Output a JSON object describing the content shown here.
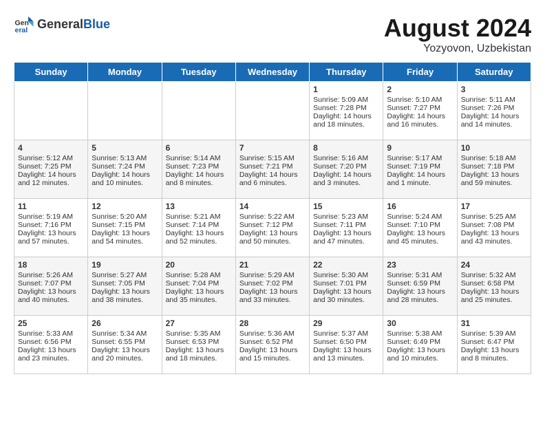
{
  "header": {
    "logo": {
      "general": "General",
      "blue": "Blue"
    },
    "title": "August 2024",
    "subtitle": "Yozyovon, Uzbekistan"
  },
  "days_of_week": [
    "Sunday",
    "Monday",
    "Tuesday",
    "Wednesday",
    "Thursday",
    "Friday",
    "Saturday"
  ],
  "weeks": [
    [
      {
        "day": "",
        "content": ""
      },
      {
        "day": "",
        "content": ""
      },
      {
        "day": "",
        "content": ""
      },
      {
        "day": "",
        "content": ""
      },
      {
        "day": "1",
        "content": "Sunrise: 5:09 AM\nSunset: 7:28 PM\nDaylight: 14 hours\nand 18 minutes."
      },
      {
        "day": "2",
        "content": "Sunrise: 5:10 AM\nSunset: 7:27 PM\nDaylight: 14 hours\nand 16 minutes."
      },
      {
        "day": "3",
        "content": "Sunrise: 5:11 AM\nSunset: 7:26 PM\nDaylight: 14 hours\nand 14 minutes."
      }
    ],
    [
      {
        "day": "4",
        "content": "Sunrise: 5:12 AM\nSunset: 7:25 PM\nDaylight: 14 hours\nand 12 minutes."
      },
      {
        "day": "5",
        "content": "Sunrise: 5:13 AM\nSunset: 7:24 PM\nDaylight: 14 hours\nand 10 minutes."
      },
      {
        "day": "6",
        "content": "Sunrise: 5:14 AM\nSunset: 7:23 PM\nDaylight: 14 hours\nand 8 minutes."
      },
      {
        "day": "7",
        "content": "Sunrise: 5:15 AM\nSunset: 7:21 PM\nDaylight: 14 hours\nand 6 minutes."
      },
      {
        "day": "8",
        "content": "Sunrise: 5:16 AM\nSunset: 7:20 PM\nDaylight: 14 hours\nand 3 minutes."
      },
      {
        "day": "9",
        "content": "Sunrise: 5:17 AM\nSunset: 7:19 PM\nDaylight: 14 hours\nand 1 minute."
      },
      {
        "day": "10",
        "content": "Sunrise: 5:18 AM\nSunset: 7:18 PM\nDaylight: 13 hours\nand 59 minutes."
      }
    ],
    [
      {
        "day": "11",
        "content": "Sunrise: 5:19 AM\nSunset: 7:16 PM\nDaylight: 13 hours\nand 57 minutes."
      },
      {
        "day": "12",
        "content": "Sunrise: 5:20 AM\nSunset: 7:15 PM\nDaylight: 13 hours\nand 54 minutes."
      },
      {
        "day": "13",
        "content": "Sunrise: 5:21 AM\nSunset: 7:14 PM\nDaylight: 13 hours\nand 52 minutes."
      },
      {
        "day": "14",
        "content": "Sunrise: 5:22 AM\nSunset: 7:12 PM\nDaylight: 13 hours\nand 50 minutes."
      },
      {
        "day": "15",
        "content": "Sunrise: 5:23 AM\nSunset: 7:11 PM\nDaylight: 13 hours\nand 47 minutes."
      },
      {
        "day": "16",
        "content": "Sunrise: 5:24 AM\nSunset: 7:10 PM\nDaylight: 13 hours\nand 45 minutes."
      },
      {
        "day": "17",
        "content": "Sunrise: 5:25 AM\nSunset: 7:08 PM\nDaylight: 13 hours\nand 43 minutes."
      }
    ],
    [
      {
        "day": "18",
        "content": "Sunrise: 5:26 AM\nSunset: 7:07 PM\nDaylight: 13 hours\nand 40 minutes."
      },
      {
        "day": "19",
        "content": "Sunrise: 5:27 AM\nSunset: 7:05 PM\nDaylight: 13 hours\nand 38 minutes."
      },
      {
        "day": "20",
        "content": "Sunrise: 5:28 AM\nSunset: 7:04 PM\nDaylight: 13 hours\nand 35 minutes."
      },
      {
        "day": "21",
        "content": "Sunrise: 5:29 AM\nSunset: 7:02 PM\nDaylight: 13 hours\nand 33 minutes."
      },
      {
        "day": "22",
        "content": "Sunrise: 5:30 AM\nSunset: 7:01 PM\nDaylight: 13 hours\nand 30 minutes."
      },
      {
        "day": "23",
        "content": "Sunrise: 5:31 AM\nSunset: 6:59 PM\nDaylight: 13 hours\nand 28 minutes."
      },
      {
        "day": "24",
        "content": "Sunrise: 5:32 AM\nSunset: 6:58 PM\nDaylight: 13 hours\nand 25 minutes."
      }
    ],
    [
      {
        "day": "25",
        "content": "Sunrise: 5:33 AM\nSunset: 6:56 PM\nDaylight: 13 hours\nand 23 minutes."
      },
      {
        "day": "26",
        "content": "Sunrise: 5:34 AM\nSunset: 6:55 PM\nDaylight: 13 hours\nand 20 minutes."
      },
      {
        "day": "27",
        "content": "Sunrise: 5:35 AM\nSunset: 6:53 PM\nDaylight: 13 hours\nand 18 minutes."
      },
      {
        "day": "28",
        "content": "Sunrise: 5:36 AM\nSunset: 6:52 PM\nDaylight: 13 hours\nand 15 minutes."
      },
      {
        "day": "29",
        "content": "Sunrise: 5:37 AM\nSunset: 6:50 PM\nDaylight: 13 hours\nand 13 minutes."
      },
      {
        "day": "30",
        "content": "Sunrise: 5:38 AM\nSunset: 6:49 PM\nDaylight: 13 hours\nand 10 minutes."
      },
      {
        "day": "31",
        "content": "Sunrise: 5:39 AM\nSunset: 6:47 PM\nDaylight: 13 hours\nand 8 minutes."
      }
    ]
  ]
}
